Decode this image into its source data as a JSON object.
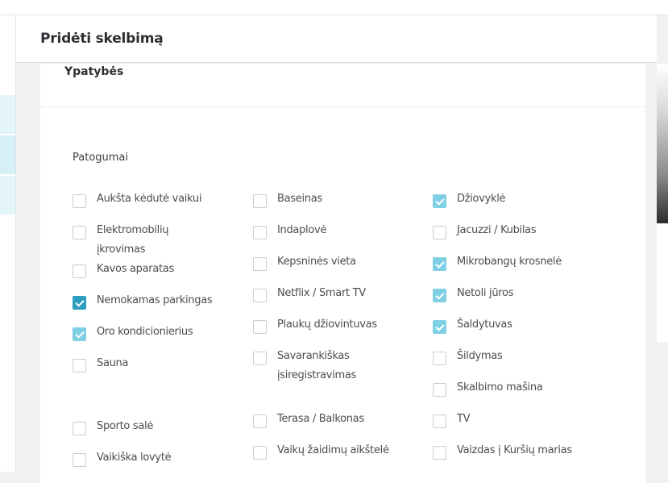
{
  "modal": {
    "title": "Pridėti skelbimą"
  },
  "section": {
    "title": "Ypatybės"
  },
  "group": {
    "title": "Patogumai"
  },
  "colors": {
    "accent": "#7fd0e4",
    "accent_strong": "#2e9ec0"
  },
  "amenities": {
    "col1": [
      {
        "label": "Aukšta kėdutė vaikui",
        "checked": false
      },
      {
        "label": "Elektromobilių įkrovimas",
        "checked": false
      },
      {
        "label": "Kavos aparatas",
        "checked": false
      },
      {
        "label": "Nemokamas parkingas",
        "checked": true
      },
      {
        "label": "Oro kondicionierius",
        "checked": true
      },
      {
        "label": "Sauna",
        "checked": false
      },
      {
        "label": "Sporto salė",
        "checked": false
      },
      {
        "label": "Vaikiška lovytė",
        "checked": false
      }
    ],
    "col2": [
      {
        "label": "Baseinas",
        "checked": false
      },
      {
        "label": "Indaplovė",
        "checked": false
      },
      {
        "label": "Kepsninės vieta",
        "checked": false
      },
      {
        "label": "Netflix / Smart TV",
        "checked": false
      },
      {
        "label": "Plaukų džiovintuvas",
        "checked": false
      },
      {
        "label": "Savarankiškas įsiregistravimas",
        "checked": false
      },
      {
        "label": "Terasa / Balkonas",
        "checked": false
      },
      {
        "label": "Vaikų žaidimų aikštelė",
        "checked": false
      }
    ],
    "col3": [
      {
        "label": "Džiovyklė",
        "checked": true
      },
      {
        "label": "Jacuzzi / Kubilas",
        "checked": false
      },
      {
        "label": "Mikrobangų krosnelė",
        "checked": true
      },
      {
        "label": "Netoli jūros",
        "checked": true
      },
      {
        "label": "Šaldytuvas",
        "checked": true
      },
      {
        "label": "Šildymas",
        "checked": false
      },
      {
        "label": "Skalbimo mašina",
        "checked": false
      },
      {
        "label": "TV",
        "checked": false
      },
      {
        "label": "Vaizdas į Kuršių marias",
        "checked": false
      }
    ]
  }
}
